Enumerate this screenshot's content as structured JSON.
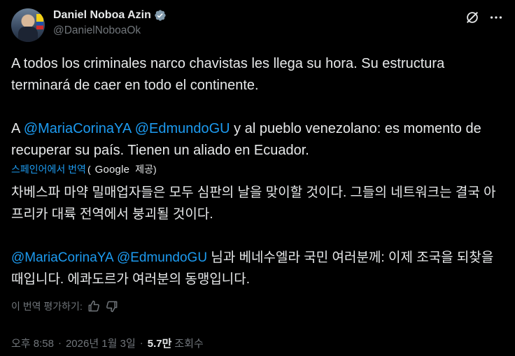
{
  "author": {
    "display_name": "Daniel Noboa Azin",
    "handle": "@DanielNoboaOk"
  },
  "post": {
    "line1": "A todos los criminales narco chavistas les llega su hora. Su estructura terminará de caer en todo el continente.",
    "p2_prefix": "A ",
    "mention1": "@MariaCorinaYA",
    "mention2": "@EdmundoGU",
    "p2_rest": " y al pueblo venezolano: es momento de recuperar su país. Tienen un aliado en Ecuador."
  },
  "translation": {
    "label": "스페인어에서 번역",
    "open_paren": "(",
    "google": "Google",
    "provider_suffix": "제공)",
    "line1": "차베스파 마약 밀매업자들은 모두 심판의 날을 맞이할 것이다. 그들의 네트워크는 결국 아프리카 대륙 전역에서 붕괴될 것이다.",
    "mention1": "@MariaCorinaYA",
    "mention2": "@EdmundoGU",
    "p2_rest": " 님과 베네수엘라 국민 여러분께: 이제 조국을 되찾을 때입니다. 에콰도르가 여러분의 동맹입니다.",
    "rate_label": "이 번역 평가하기:"
  },
  "meta": {
    "time": "오후 8:58",
    "sep1": "·",
    "date": "2026년 1월 3일",
    "sep2": "·",
    "views_count": "5.7만",
    "views_label": "조회수"
  },
  "icons": {
    "verified": "verified-badge-icon",
    "grok": "grok-icon",
    "more": "more-icon",
    "thumbs_up": "thumbs-up-icon",
    "thumbs_down": "thumbs-down-icon"
  },
  "colors": {
    "background": "#000000",
    "text": "#e7e9ea",
    "secondary": "#71767b",
    "accent": "#1d9bf0"
  }
}
